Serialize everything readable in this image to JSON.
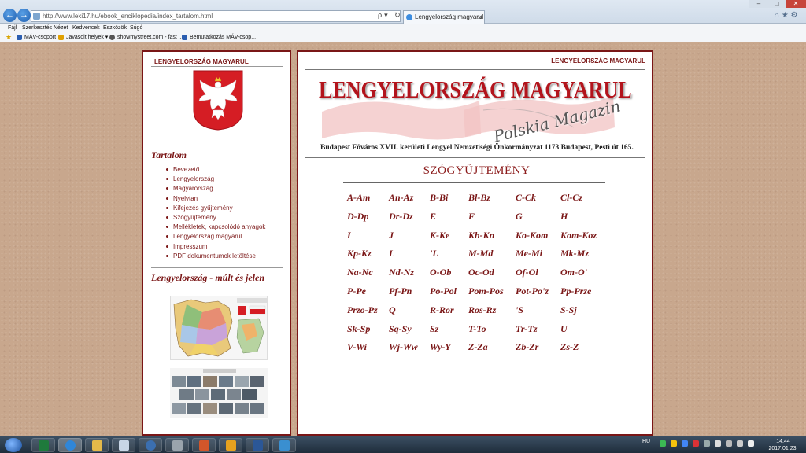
{
  "browser": {
    "url": "http://www.leki17.hu/ebook_enciklopedia/index_tartalom.html",
    "tab_title": "Lengyelország magyarul",
    "tab_close": "×",
    "back_glyph": "←",
    "forward_glyph": "→",
    "addr_tools": "ρ▾ ↻",
    "window_controls": {
      "minimize": "–",
      "maximize": "□",
      "close": "✕"
    },
    "right_icons": "⌂ ★ ⚙",
    "menu": [
      "Fájl",
      "Szerkesztés",
      "Nézet",
      "Kedvencek",
      "Eszközök",
      "Súgó"
    ],
    "favorites": [
      {
        "label": "MÁV-csoport",
        "icon": "mav-icon"
      },
      {
        "label": "Javasolt helyek ▾",
        "icon": "suggested-sites-icon"
      },
      {
        "label": "showmystreet.com - fast ...",
        "icon": "globe-icon"
      },
      {
        "label": "Bemutatkozás MÁV-csop...",
        "icon": "mav-icon"
      }
    ],
    "favorites_star": "★"
  },
  "sidebar": {
    "header": "LENGYELORSZÁG MAGYARUL",
    "toc_title": "Tartalom",
    "toc": [
      "Bevezető",
      "Lengyelország",
      "Magyarország",
      "Nyelvtan",
      "Kifejezés gyűjtemény",
      "Szógyűjtemény",
      "Mellékletek, kapcsolódó anyagok",
      "Lengyelország magyarul",
      "Impresszum",
      "PDF dokumentumok letöltése"
    ],
    "section2_title": "Lengyelország - múlt és jelen"
  },
  "main": {
    "header": "LENGYELORSZÁG MAGYARUL",
    "banner_title": "LENGYELORSZÁG MAGYARUL",
    "banner_script": "Polskia Magazin",
    "banner_subtitle": "Budapest Főváros XVII. kerületi Lengyel Nemzetiségi Önkormányzat 1173 Budapest, Pesti út 165.",
    "collection_title": "SZÓGYŰJTEMÉNY",
    "letter_rows": [
      [
        "A-Am",
        "An-Az",
        "B-Bi",
        "Bl-Bz",
        "C-Ck",
        "Cl-Cz"
      ],
      [
        "D-Dp",
        "Dr-Dz",
        "E",
        "F",
        "G",
        "H"
      ],
      [
        "I",
        "J",
        "K-Ke",
        "Kh-Kn",
        "Ko-Kom",
        "Kom-Koz"
      ],
      [
        "Kp-Kz",
        "L",
        "'L",
        "M-Md",
        "Me-Mi",
        "Mk-Mz"
      ],
      [
        "Na-Nc",
        "Nd-Nz",
        "O-Ob",
        "Oc-Od",
        "Of-Ol",
        "Om-O'"
      ],
      [
        "P-Pe",
        "Pf-Pn",
        "Po-Pol",
        "Pom-Pos",
        "Pot-Po'z",
        "Pp-Prze"
      ],
      [
        "Przo-Pz",
        "Q",
        "R-Ror",
        "Ros-Rz",
        "'S",
        "S-Sj"
      ],
      [
        "Sk-Sp",
        "Sq-Sy",
        "Sz",
        "T-To",
        "Tr-Tz",
        "U"
      ],
      [
        "V-Wi",
        "Wj-Ww",
        "Wy-Y",
        "Z-Za",
        "Zb-Zr",
        "Zs-Z"
      ]
    ]
  },
  "taskbar": {
    "apps": [
      "excel-icon",
      "internet-explorer-icon",
      "file-explorer-icon",
      "document-icon",
      "google-earth-icon",
      "tool-icon",
      "powerpoint-icon",
      "outlook-icon",
      "word-icon",
      "language-icon"
    ],
    "lang": "HU",
    "time": "14:44",
    "date": "2017.01.23."
  },
  "colors": {
    "accent": "#7a1616",
    "banner_red": "#b3141c",
    "page_bg": "#c8a78d"
  }
}
